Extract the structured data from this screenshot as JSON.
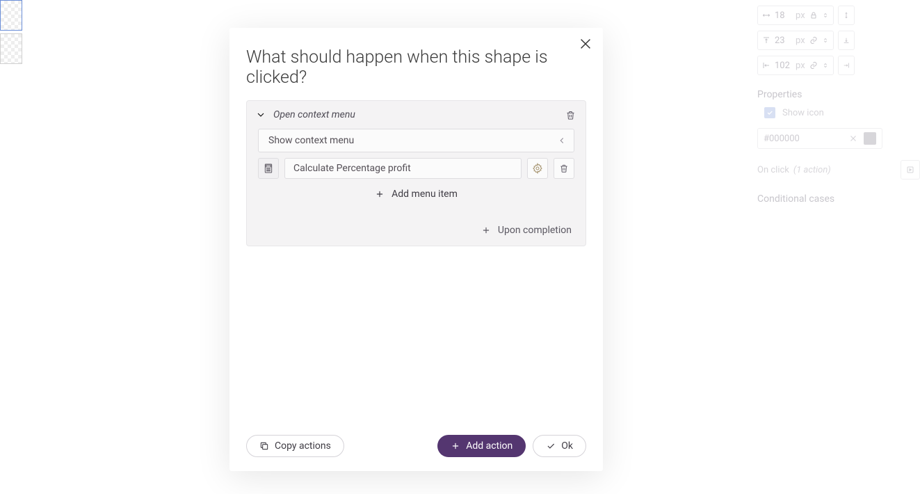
{
  "modal": {
    "title": "What should happen when this shape is clicked?",
    "action_card": {
      "title": "Open context menu",
      "select_label": "Show context menu",
      "menu_items": [
        {
          "text": "Calculate Percentage profit"
        }
      ],
      "add_item_label": "Add menu item",
      "upon_completion_label": "Upon completion"
    },
    "footer": {
      "copy_label": "Copy actions",
      "add_label": "Add action",
      "ok_label": "Ok"
    }
  },
  "right_panel": {
    "dims": [
      {
        "value": "18",
        "unit": "px"
      },
      {
        "value": "23",
        "unit": "px"
      },
      {
        "value": "102",
        "unit": "px"
      }
    ],
    "properties_header": "Properties",
    "show_icon_label": "Show icon",
    "color_hex": "#000000",
    "onclick_label": "On click",
    "onclick_count": "(1 action)",
    "conditional_label": "Conditional cases"
  }
}
